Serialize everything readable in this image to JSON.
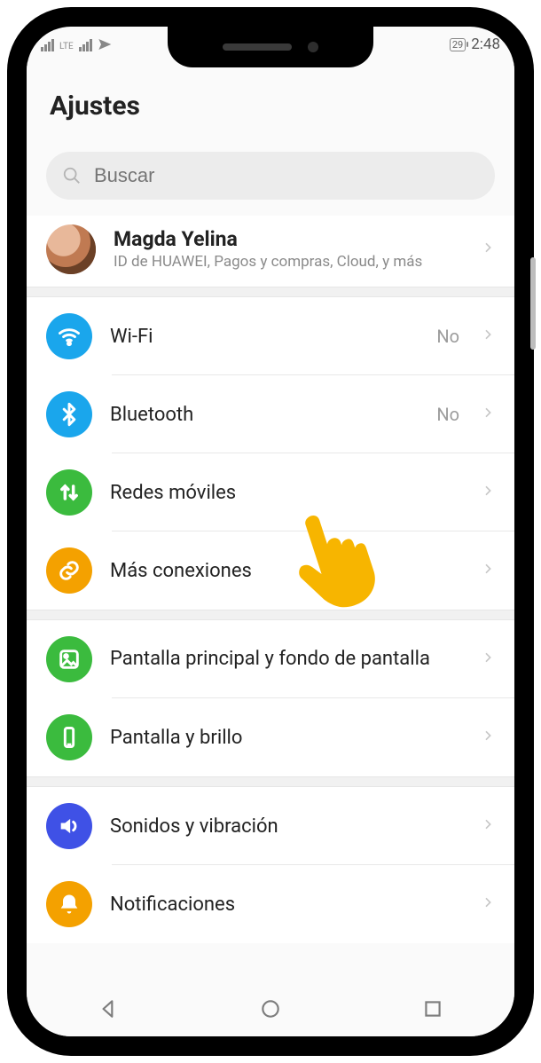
{
  "status": {
    "battery": "29",
    "time": "2:48"
  },
  "title": "Ajustes",
  "search": {
    "placeholder": "Buscar"
  },
  "account": {
    "name": "Magda Yelina",
    "subtitle": "ID de HUAWEI, Pagos y compras, Cloud, y más"
  },
  "rows": {
    "wifi": {
      "label": "Wi-Fi",
      "value": "No"
    },
    "bluetooth": {
      "label": "Bluetooth",
      "value": "No"
    },
    "mobile": {
      "label": "Redes móviles"
    },
    "more": {
      "label": "Más conexiones"
    },
    "home": {
      "label": "Pantalla principal y fondo de pantalla"
    },
    "display": {
      "label": "Pantalla y brillo"
    },
    "sound": {
      "label": "Sonidos y vibración"
    },
    "notif": {
      "label": "Notificaciones"
    }
  },
  "pointer_target": "mobile"
}
